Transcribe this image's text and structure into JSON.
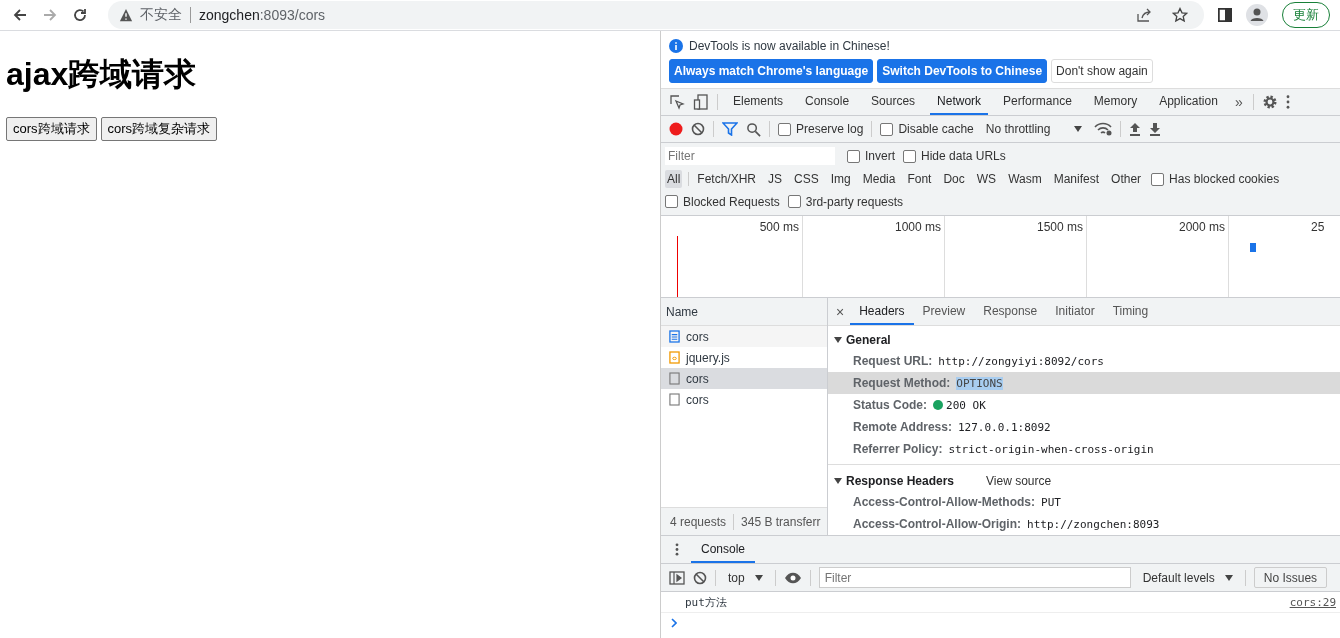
{
  "browser": {
    "security_label": "不安全",
    "url_host": "zongchen",
    "url_rest": ":8093/cors",
    "update_button": "更新"
  },
  "page": {
    "heading": "ajax跨域请求",
    "buttons": [
      "cors跨域请求",
      "cors跨域复杂请求"
    ]
  },
  "devtools": {
    "banner": {
      "message": "DevTools is now available in Chinese!",
      "buttons": [
        {
          "label": "Always match Chrome's language",
          "kind": "primary"
        },
        {
          "label": "Switch DevTools to Chinese",
          "kind": "primary"
        },
        {
          "label": "Don't show again",
          "kind": "secondary"
        }
      ]
    },
    "tabs": [
      {
        "label": "Elements",
        "selected": false
      },
      {
        "label": "Console",
        "selected": false
      },
      {
        "label": "Sources",
        "selected": false
      },
      {
        "label": "Network",
        "selected": true
      },
      {
        "label": "Performance",
        "selected": false
      },
      {
        "label": "Memory",
        "selected": false
      },
      {
        "label": "Application",
        "selected": false
      }
    ],
    "more_tabs": "»",
    "toolbar": {
      "recording": true,
      "preserve_log": {
        "label": "Preserve log",
        "checked": false
      },
      "disable_cache": {
        "label": "Disable cache",
        "checked": false
      },
      "throttling": "No throttling"
    },
    "filter": {
      "placeholder": "Filter",
      "invert": {
        "label": "Invert",
        "checked": false
      },
      "hide_data_urls": {
        "label": "Hide data URLs",
        "checked": false
      },
      "types": [
        {
          "label": "All",
          "selected": true
        },
        {
          "label": "Fetch/XHR",
          "selected": false
        },
        {
          "label": "JS",
          "selected": false
        },
        {
          "label": "CSS",
          "selected": false
        },
        {
          "label": "Img",
          "selected": false
        },
        {
          "label": "Media",
          "selected": false
        },
        {
          "label": "Font",
          "selected": false
        },
        {
          "label": "Doc",
          "selected": false
        },
        {
          "label": "WS",
          "selected": false
        },
        {
          "label": "Wasm",
          "selected": false
        },
        {
          "label": "Manifest",
          "selected": false
        },
        {
          "label": "Other",
          "selected": false
        }
      ],
      "has_blocked_cookies": {
        "label": "Has blocked cookies",
        "checked": false
      },
      "blocked_requests": {
        "label": "Blocked Requests",
        "checked": false
      },
      "third_party": {
        "label": "3rd-party requests",
        "checked": false
      }
    },
    "timeline": {
      "ticks": [
        "500 ms",
        "1000 ms",
        "1500 ms",
        "2000 ms",
        "25"
      ]
    },
    "requests": {
      "column": "Name",
      "rows": [
        {
          "name": "cors",
          "kind": "document",
          "selected": false
        },
        {
          "name": "jquery.js",
          "kind": "script",
          "selected": false
        },
        {
          "name": "cors",
          "kind": "other",
          "selected": true
        },
        {
          "name": "cors",
          "kind": "other",
          "selected": false
        }
      ],
      "summary": "4 requests",
      "transferred": "345 B transferr"
    },
    "detail": {
      "close": "×",
      "tabs": [
        {
          "label": "Headers",
          "selected": true
        },
        {
          "label": "Preview",
          "selected": false
        },
        {
          "label": "Response",
          "selected": false
        },
        {
          "label": "Initiator",
          "selected": false
        },
        {
          "label": "Timing",
          "selected": false
        }
      ],
      "sections": [
        {
          "title": "General",
          "expanded": true,
          "fields": [
            {
              "label": "Request URL:",
              "value": "http://zongyiyi:8092/cors",
              "selected": false
            },
            {
              "label": "Request Method:",
              "value": "OPTIONS",
              "selected": true
            },
            {
              "label": "Status Code:",
              "value": "200 OK",
              "selected": false,
              "color": "#1aa260"
            },
            {
              "label": "Remote Address:",
              "value": "127.0.0.1:8092",
              "selected": false
            },
            {
              "label": "Referrer Policy:",
              "value": "strict-origin-when-cross-origin",
              "selected": false
            }
          ]
        },
        {
          "title": "Response Headers",
          "expanded": true,
          "link": "View source",
          "fields": [
            {
              "label": "Access-Control-Allow-Methods:",
              "value": "PUT",
              "selected": false
            },
            {
              "label": "Access-Control-Allow-Origin:",
              "value": "http://zongchen:8093",
              "selected": false
            }
          ]
        }
      ]
    },
    "drawer": {
      "tab": {
        "label": "Console",
        "selected": true
      },
      "context": "top",
      "filter_placeholder": "Filter",
      "levels": "Default levels",
      "issues": "No Issues",
      "messages": [
        {
          "text": "put方法",
          "source": "cors:29"
        }
      ]
    }
  }
}
